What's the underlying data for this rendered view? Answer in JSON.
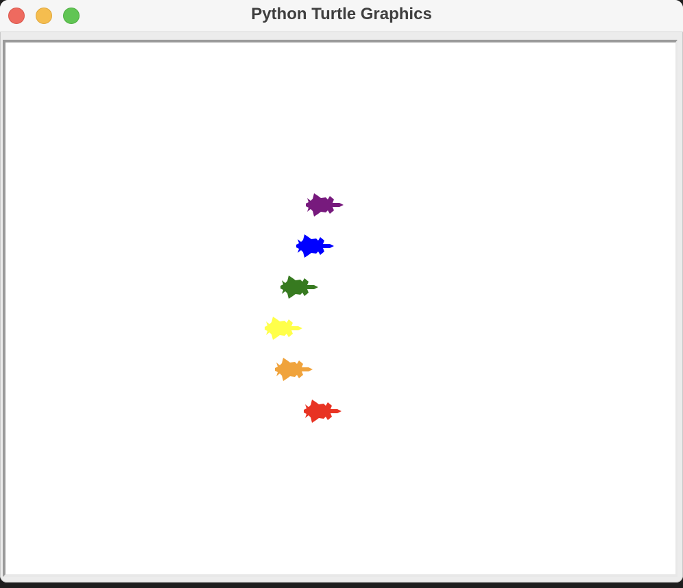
{
  "window": {
    "title": "Python Turtle Graphics",
    "controls": [
      {
        "name": "close",
        "color": "#ee6a5f"
      },
      {
        "name": "minimize",
        "color": "#f5bd4f"
      },
      {
        "name": "zoom",
        "color": "#61c554"
      }
    ]
  },
  "canvas": {
    "background": "#ffffff",
    "turtles": [
      {
        "name": "purple-turtle",
        "color": "#771a7d",
        "heading": 0
      },
      {
        "name": "blue-turtle",
        "color": "#0000ff",
        "heading": 0
      },
      {
        "name": "green-turtle",
        "color": "#377a20",
        "heading": 0
      },
      {
        "name": "yellow-turtle",
        "color": "#ffff4a",
        "heading": 0
      },
      {
        "name": "orange-turtle",
        "color": "#f0a33c",
        "heading": 0
      },
      {
        "name": "red-turtle",
        "color": "#e83323",
        "heading": 0
      }
    ]
  }
}
